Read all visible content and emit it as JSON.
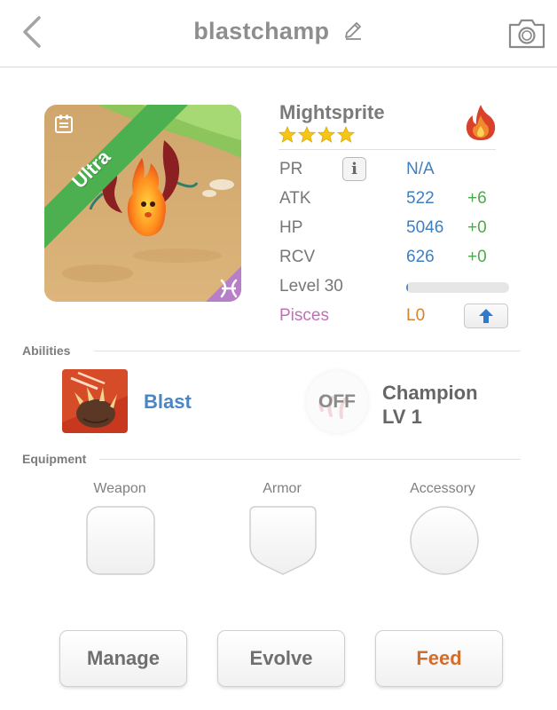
{
  "header": {
    "title": "blastchamp",
    "back_icon": "chevron-left-icon",
    "edit_icon": "pencil-icon",
    "camera_icon": "camera-icon"
  },
  "portrait": {
    "rarity_label": "Ultra",
    "rarity_color": "#4caf50",
    "zodiac_icon": "pisces-icon",
    "zodiac_color": "#b77fc7",
    "card_icon": "card-icon"
  },
  "monster": {
    "name": "Mightsprite",
    "stars": 4,
    "element_icon": "fire-element-icon",
    "element_color": "#e0542a"
  },
  "stats": [
    {
      "label": "PR",
      "value": "N/A",
      "bonus": ""
    },
    {
      "label": "ATK",
      "value": "522",
      "bonus": "+6"
    },
    {
      "label": "HP",
      "value": "5046",
      "bonus": "+0"
    },
    {
      "label": "RCV",
      "value": "626",
      "bonus": "+0"
    }
  ],
  "level": {
    "label": "Level 30",
    "progress": 0.02
  },
  "zodiac": {
    "label": "Pisces",
    "level": "L0"
  },
  "sections": {
    "abilities": "Abilities",
    "equipment": "Equipment"
  },
  "ability": {
    "name": "Blast",
    "toggle_state": "OFF",
    "champion_line1": "Champion",
    "champion_line2": "LV 1"
  },
  "equipment": [
    {
      "label": "Weapon",
      "shape": "rounded-square"
    },
    {
      "label": "Armor",
      "shape": "shield"
    },
    {
      "label": "Accessory",
      "shape": "circle"
    }
  ],
  "buttons": {
    "manage": "Manage",
    "evolve": "Evolve",
    "feed": "Feed"
  },
  "colors": {
    "stat_value": "#3e7fc0",
    "stat_bonus": "#4fa84f",
    "pisces": "#c36db9",
    "feed": "#d26d2c",
    "button_text": "#6f6f6f"
  }
}
